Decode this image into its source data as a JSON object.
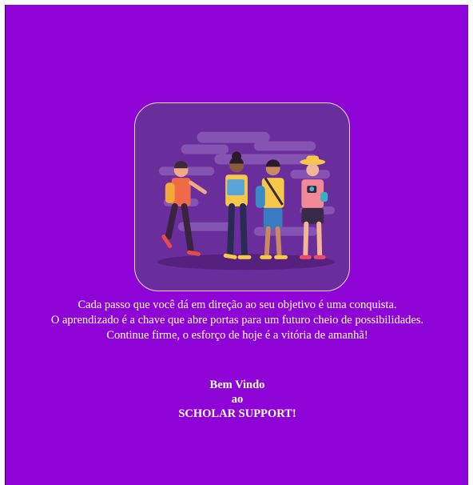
{
  "intro": {
    "lines": [
      "Cada passo que você dá em direção ao seu objetivo é uma conquista.",
      "O aprendizado é a chave que abre portas para um futuro cheio de possibilidades.",
      "Continue firme, o esforço de hoje é a vitória de amanhã!"
    ]
  },
  "welcome": {
    "line1": "Bem Vindo",
    "line2": "ao",
    "line3": "SCHOLAR SUPPORT!"
  },
  "colors": {
    "background": "#8e04d6",
    "card": "#6a2e9c",
    "text": "#ffffff"
  },
  "illustration": {
    "icon": "students-group-illustration"
  }
}
